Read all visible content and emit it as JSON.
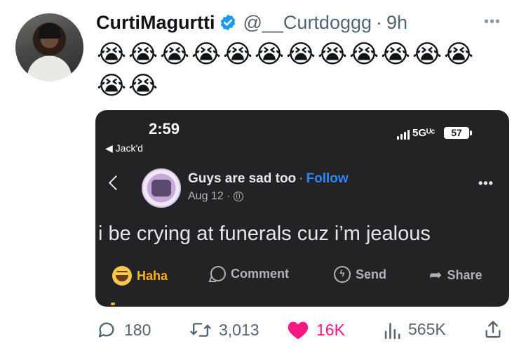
{
  "tweet": {
    "display_name": "CurtiMagurtti",
    "handle": "@__Curtdoggg",
    "separator": "·",
    "time_ago": "9h",
    "more_icon": "more-dots",
    "emoji_line1": [
      "😭",
      "😭",
      "😭",
      "😭",
      "😭",
      "😭",
      "😭",
      "😭",
      "😭",
      "😭",
      "😭",
      "😭"
    ],
    "emoji_line2": [
      "😭",
      "😭"
    ]
  },
  "embedded": {
    "status_time": "2:59",
    "back_label": "◀ Jack'd",
    "network": "5Gᵁᶜ",
    "battery": "57",
    "post": {
      "page_name": "Guys are sad too",
      "separator": "·",
      "follow_label": "Follow",
      "date": "Aug 12 ·",
      "text": "i be crying at funerals cuz i’m jealous",
      "actions": {
        "haha": "Haha",
        "comment": "Comment",
        "send": "Send",
        "share": "Share"
      }
    }
  },
  "stats": {
    "replies": "180",
    "retweets": "3,013",
    "likes": "16K",
    "views": "565K"
  },
  "colors": {
    "verified": "#1d9bf0",
    "like": "#f91880",
    "follow": "#2d88ff",
    "haha": "#f7b125",
    "card_bg": "#232325"
  }
}
